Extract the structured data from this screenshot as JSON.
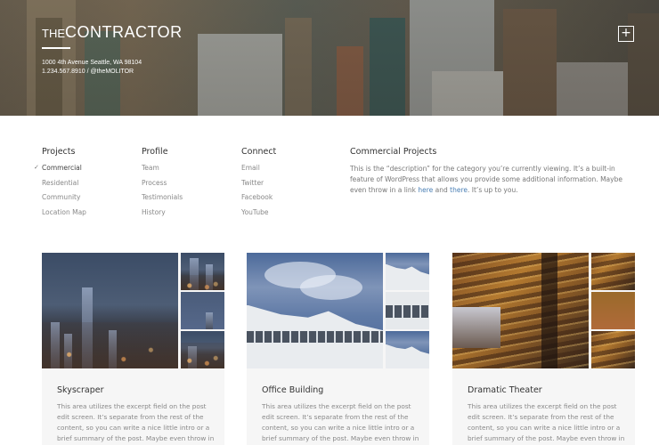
{
  "header": {
    "brand_prefix": "THE",
    "brand_name": "CONTRACTOR",
    "address": "1000 4th Avenue Seattle, WA 98104",
    "contact": "1.234.567.8910  /  @theMOLITOR",
    "menu_button_icon": "plus-icon",
    "menu_button_glyph": "+"
  },
  "nav": {
    "projects": {
      "title": "Projects",
      "items": [
        {
          "label": "Commercial",
          "active": true,
          "marker": "✓"
        },
        {
          "label": "Residential"
        },
        {
          "label": "Community"
        },
        {
          "label": "Location Map"
        }
      ]
    },
    "profile": {
      "title": "Profile",
      "items": [
        {
          "label": "Team"
        },
        {
          "label": "Process"
        },
        {
          "label": "Testimonials"
        },
        {
          "label": "History"
        }
      ]
    },
    "connect": {
      "title": "Connect",
      "items": [
        {
          "label": "Email"
        },
        {
          "label": "Twitter"
        },
        {
          "label": "Facebook"
        },
        {
          "label": "YouTube"
        }
      ]
    }
  },
  "category": {
    "title": "Commercial Projects",
    "text_before": "This is the “description” for the category you’re currently viewing. It’s a built-in feature of WordPress that allows you provide some additional information. Maybe even throw in a link ",
    "link1": "here",
    "text_mid": " and ",
    "link2": "there",
    "text_after": ". It’s up to you."
  },
  "colors": {
    "link": "#4a7fb5",
    "card_bg": "#f6f6f6",
    "heading": "#333333",
    "body_text": "#888888"
  },
  "projects": [
    {
      "title": "Skyscraper",
      "excerpt": "This area utilizes the excerpt field on the post edit screen. It’s separate from the rest of the content, so you can write a nice little intro or a brief summary of the post. Maybe even throw in",
      "image": "city-skyline-night"
    },
    {
      "title": "Office Building",
      "excerpt": "This area utilizes the excerpt field on the post edit screen. It’s separate from the rest of the content, so you can write a nice little intro or a brief summary of the post. Maybe even throw in",
      "image": "white-office-facade"
    },
    {
      "title": "Dramatic Theater",
      "excerpt": "This area utilizes the excerpt field on the post edit screen. It’s separate from the rest of the content, so you can write a nice little intro or a brief summary of the post. Maybe even throw in",
      "image": "opera-house-interior"
    }
  ]
}
